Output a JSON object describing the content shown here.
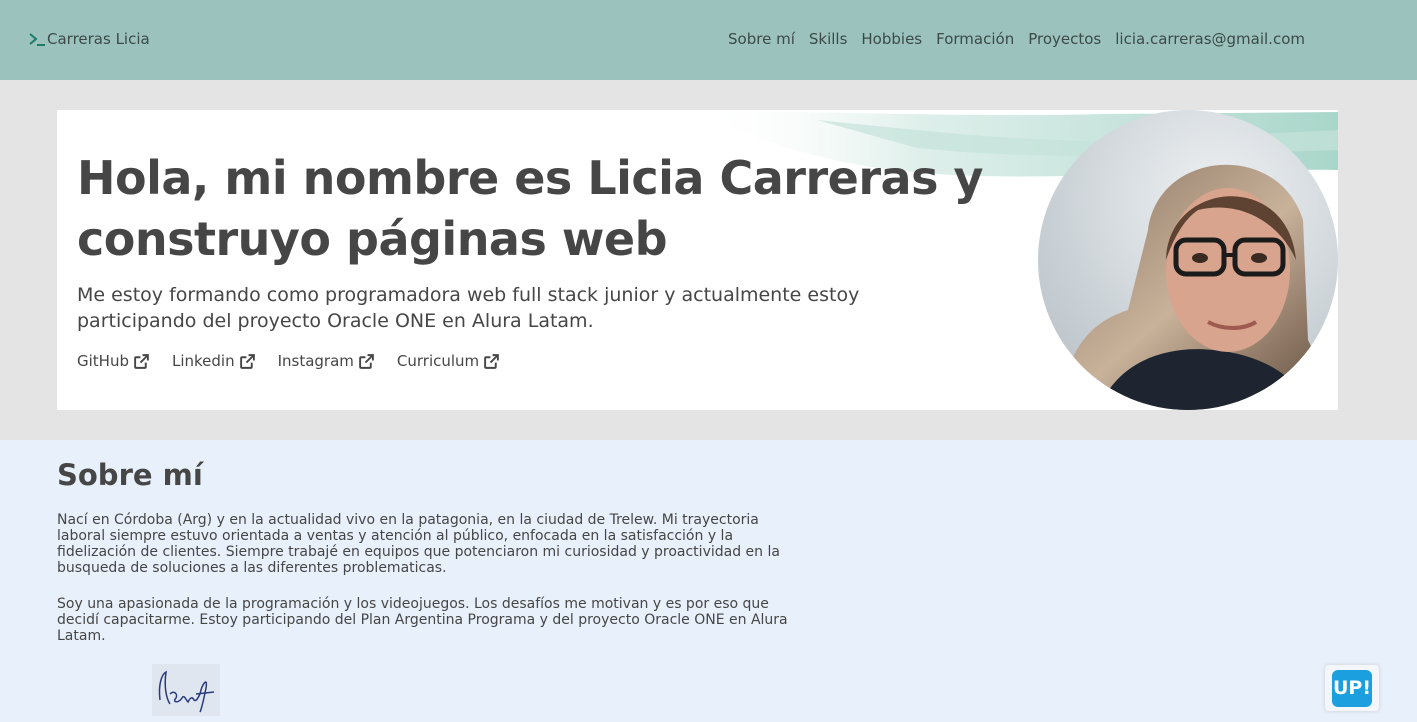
{
  "header": {
    "brand": "Carreras Licia",
    "nav": [
      {
        "label": "Sobre mí"
      },
      {
        "label": "Skills"
      },
      {
        "label": "Hobbies"
      },
      {
        "label": "Formación"
      },
      {
        "label": "Proyectos"
      },
      {
        "label": "licia.carreras@gmail.com"
      }
    ]
  },
  "hero": {
    "title": "Hola, mi nombre es Licia Carreras y construyo páginas web",
    "subtitle": "Me estoy formando como programadora web full stack junior y actualmente estoy participando del proyecto Oracle ONE en Alura Latam.",
    "links": [
      {
        "label": "GitHub",
        "icon": "external-link-icon"
      },
      {
        "label": "Linkedin",
        "icon": "external-link-icon"
      },
      {
        "label": "Instagram",
        "icon": "external-link-icon"
      },
      {
        "label": "Curriculum",
        "icon": "external-link-icon"
      }
    ]
  },
  "about": {
    "title": "Sobre mí",
    "paragraphs": [
      "Nací en Córdoba (Arg) y en la actualidad vivo en la patagonia, en la ciudad de Trelew. Mi trayectoria laboral siempre estuvo orientada a ventas y atención al público, enfocada en la satisfacción y la fidelización de clientes. Siempre trabajé en equipos que potenciaron mi curiosidad y proactividad en la busqueda de soluciones a las diferentes problematicas.",
      "Soy una apasionada de la programación y los videojuegos. Los desafíos me motivan y es por eso que decidí capacitarme. Estoy participando del Plan Argentina Programa y del proyecto Oracle ONE en Alura Latam."
    ]
  },
  "up_button": {
    "label": "UP!"
  },
  "colors": {
    "header_bg": "#9cc2be",
    "page_bg": "#e4e4e4",
    "about_bg": "#e8f0fb",
    "text": "#464646",
    "accent": "#1b9fde",
    "brand_icon": "#1f7a6a"
  }
}
